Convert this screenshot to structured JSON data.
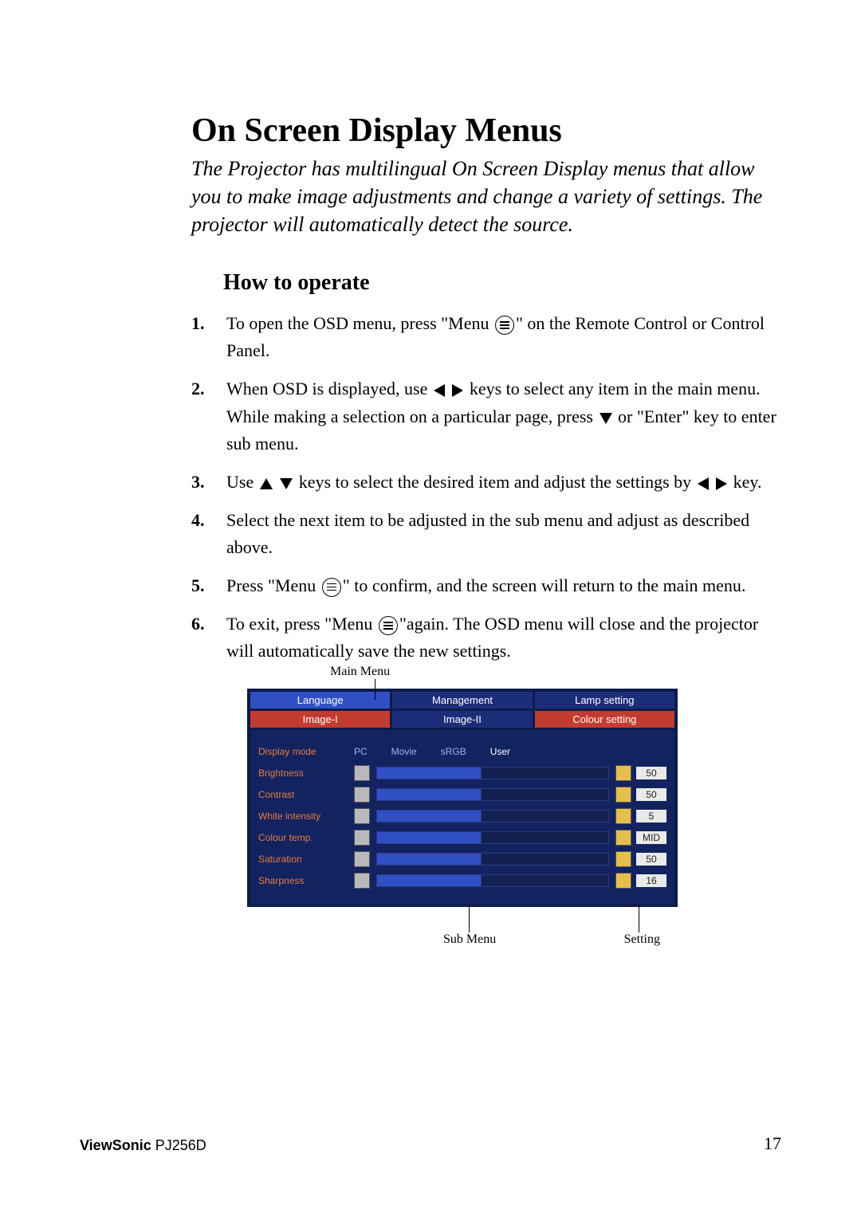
{
  "title": "On Screen Display Menus",
  "intro": "The Projector has multilingual On Screen Display menus that allow you to make image adjustments and change a variety of settings. The projector will automatically detect the source.",
  "section_heading": "How to operate",
  "steps": {
    "s1a": "To open the OSD menu, press \"Menu ",
    "s1b": "\" on the Remote Control or Control Panel.",
    "s2a": "When OSD is displayed, use ",
    "s2b": " keys to select any item in the main menu.  While making a selection on a particular page, press ",
    "s2c": " or \"Enter\" key to enter sub menu.",
    "s3a": "Use ",
    "s3b": " keys to select the desired item and adjust the settings by ",
    "s3c": " key.",
    "s4": "Select the next item to be adjusted in the sub menu and adjust as described above.",
    "s5a": "Press \"Menu ",
    "s5b": "\" to confirm, and the screen will return to the main menu.",
    "s6a": "To exit, press \"Menu ",
    "s6b": "\"again.  The OSD menu will close and the projector will automatically save the new settings."
  },
  "labels": {
    "main_menu": "Main Menu",
    "sub_menu": "Sub Menu",
    "setting": "Setting"
  },
  "osd": {
    "tabs_row1": [
      "Language",
      "Management",
      "Lamp setting"
    ],
    "tabs_row2": [
      "Image-I",
      "Image-II",
      "Colour setting"
    ],
    "rows": [
      {
        "label": "Display mode",
        "modes": [
          "PC",
          "Movie",
          "sRGB",
          "User"
        ],
        "active": "User"
      },
      {
        "label": "Brightness",
        "value": "50"
      },
      {
        "label": "Contrast",
        "value": "50"
      },
      {
        "label": "White intensity",
        "value": "5"
      },
      {
        "label": "Colour temp.",
        "value": "MID"
      },
      {
        "label": "Saturation",
        "value": "50"
      },
      {
        "label": "Sharpness",
        "value": "16"
      }
    ]
  },
  "footer": {
    "brand": "ViewSonic",
    "model": " PJ256D",
    "page": "17"
  }
}
